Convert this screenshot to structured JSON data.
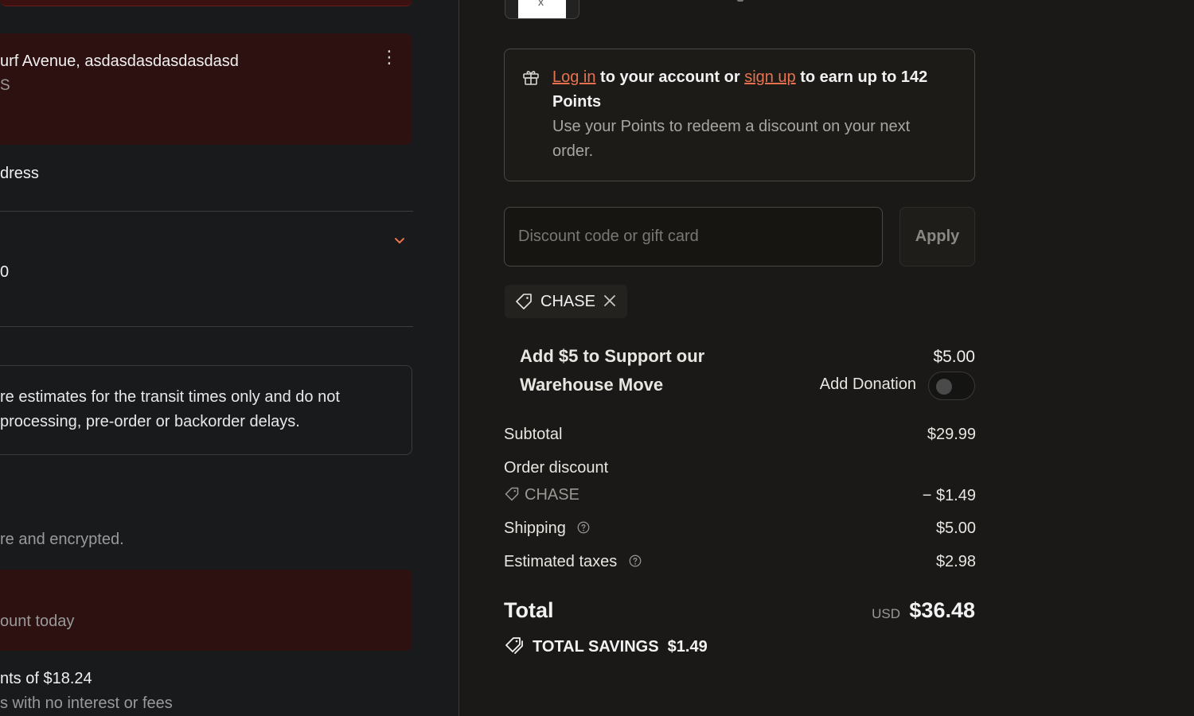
{
  "left": {
    "address_line1": "urf Avenue, asdasdasdasdasdasd",
    "address_line2": "S",
    "address_label": "dress",
    "zero_text": "0",
    "notice_line1": "re estimates for the transit times only and do not",
    "notice_line2": "processing, pre-order or backorder delays.",
    "secure_text": "re and encrypted.",
    "pay_today": "ount today",
    "install_line1": "nts of $18.24",
    "install_line2": "s with no interest or fees"
  },
  "points": {
    "login_link": "Log in",
    "mid_text": " to your account or ",
    "signup_link": "sign up",
    "tail_text": " to earn up to 142",
    "line2": "Points",
    "line3": "Use your Points to redeem a discount on your next",
    "line4": "order."
  },
  "discount": {
    "placeholder": "Discount code or gift card",
    "value": "",
    "apply_label": "Apply",
    "code_chip": "CHASE"
  },
  "donation": {
    "title_line1": "Add $5 to Support our",
    "title_line2": "Warehouse Move",
    "price": "$5.00",
    "toggle_label": "Add Donation",
    "enabled": false
  },
  "summary": {
    "subtotal_label": "Subtotal",
    "subtotal_value": "$29.99",
    "order_discount_label": "Order discount",
    "discount_code": "CHASE",
    "discount_value": "− $1.49",
    "shipping_label": "Shipping",
    "shipping_value": "$5.00",
    "taxes_label": "Estimated taxes",
    "taxes_value": "$2.98",
    "total_label": "Total",
    "currency": "USD",
    "total_value": "$36.48",
    "savings_label": "TOTAL SAVINGS",
    "savings_value": "$1.49"
  },
  "colors": {
    "accent_link": "#e8724f",
    "card_red": "#2d1010",
    "bg_right": "#1a1917",
    "bg_left": "#181a1c"
  }
}
